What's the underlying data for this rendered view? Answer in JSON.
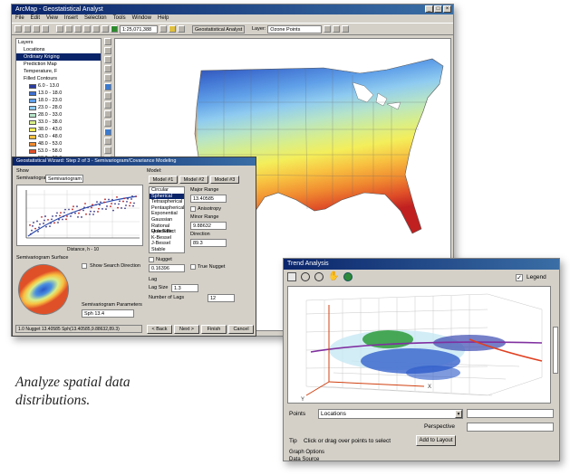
{
  "main_window": {
    "title": "ArcMap - Geostatistical Analyst",
    "menu": [
      "File",
      "Edit",
      "View",
      "Insert",
      "Selection",
      "Tools",
      "Window",
      "Help"
    ],
    "scale": "1:25,071,388",
    "analyst_menu": "Geostatistical Analyst",
    "layer_label": "Layer:",
    "layer_value": "Ozone Points"
  },
  "toc": {
    "items": [
      {
        "label": "Layers",
        "color": "",
        "selected": false
      },
      {
        "label": "Locations",
        "color": "",
        "selected": false
      },
      {
        "label": "Ordinary Kriging",
        "color": "",
        "selected": true
      },
      {
        "label": "Prediction Map",
        "color": "",
        "selected": false
      },
      {
        "label": "Temperature, F",
        "color": "",
        "selected": false
      },
      {
        "label": "Filled Contours",
        "color": "",
        "selected": false
      },
      {
        "label": "6.0 - 13.0",
        "color": "#2b3da0",
        "selected": false
      },
      {
        "label": "13.0 - 18.0",
        "color": "#3e6fd0",
        "selected": false
      },
      {
        "label": "18.0 - 23.0",
        "color": "#5f9fe8",
        "selected": false
      },
      {
        "label": "23.0 - 28.0",
        "color": "#8fcbf0",
        "selected": false
      },
      {
        "label": "28.0 - 33.0",
        "color": "#b6e4c8",
        "selected": false
      },
      {
        "label": "33.0 - 38.0",
        "color": "#d8ee8a",
        "selected": false
      },
      {
        "label": "38.0 - 43.0",
        "color": "#f4ee5a",
        "selected": false
      },
      {
        "label": "43.0 - 48.0",
        "color": "#f8c040",
        "selected": false
      },
      {
        "label": "48.0 - 53.0",
        "color": "#f08a30",
        "selected": false
      },
      {
        "label": "53.0 - 58.0",
        "color": "#e05028",
        "selected": false
      },
      {
        "label": "58.0 - 63.0",
        "color": "#c02020",
        "selected": false
      },
      {
        "label": "States",
        "color": "",
        "selected": false
      }
    ]
  },
  "wizard": {
    "title": "Geostatistical Wizard: Step 2 of 3 - Semivariogram/Covariance Modeling",
    "show_label": "Show",
    "semivariogram_label": "Semivariogram",
    "semivariogram_value": "Semivariogram",
    "model_label": "Model:",
    "model_tabs": [
      "Model #1",
      "Model #2",
      "Model #3"
    ],
    "model_list": [
      "Circular",
      "Spherical",
      "Tetraspherical",
      "Pentaspherical",
      "Exponential",
      "Gaussian",
      "Rational Quadratic",
      "Hole Effect",
      "K-Bessel",
      "J-Bessel",
      "Stable"
    ],
    "major_range_label": "Major Range",
    "major_range_value": "13.40585",
    "anisotropy_label": "Anisotropy",
    "minor_range_label": "Minor Range",
    "minor_range_value": "9.88632",
    "direction_label": "Direction",
    "direction_value": "89.3",
    "nugget_label": "Nugget",
    "nugget_value": "0.16396",
    "true_nugget_label": "True Nugget",
    "lag_label": "Lag",
    "lag_size_label": "Lag Size",
    "lag_size_value": "1.3",
    "lag_count_label": "Number of Lags",
    "lag_count_value": "12",
    "surface_label": "Semivariogram Surface",
    "show_search_label": "Show Search Direction",
    "parameter_label": "Semivariogram Parameters",
    "parameter_value": "Sph 13.4",
    "xaxis_label": "Distance, h - 10",
    "status_text": "1.0 Nugget 13.40585 Sph(13.40585,9.88632,89.3)",
    "buttons": {
      "back": "< Back",
      "next": "Next >",
      "finish": "Finish",
      "cancel": "Cancel"
    }
  },
  "trend": {
    "title": "Trend Analysis",
    "legend_label": "Legend",
    "points_label": "Points",
    "points_value": "Locations",
    "perspective_label": "Perspective",
    "tip_label": "Tip",
    "tip_text": "Click or drag over points to select",
    "add_layout_label": "Add to Layout",
    "graph_options_label": "Graph Options",
    "data_source_label": "Data Source",
    "axis_x": "X",
    "axis_y": "Y"
  },
  "caption": {
    "line1": "Analyze spatial data",
    "line2": "distributions."
  }
}
